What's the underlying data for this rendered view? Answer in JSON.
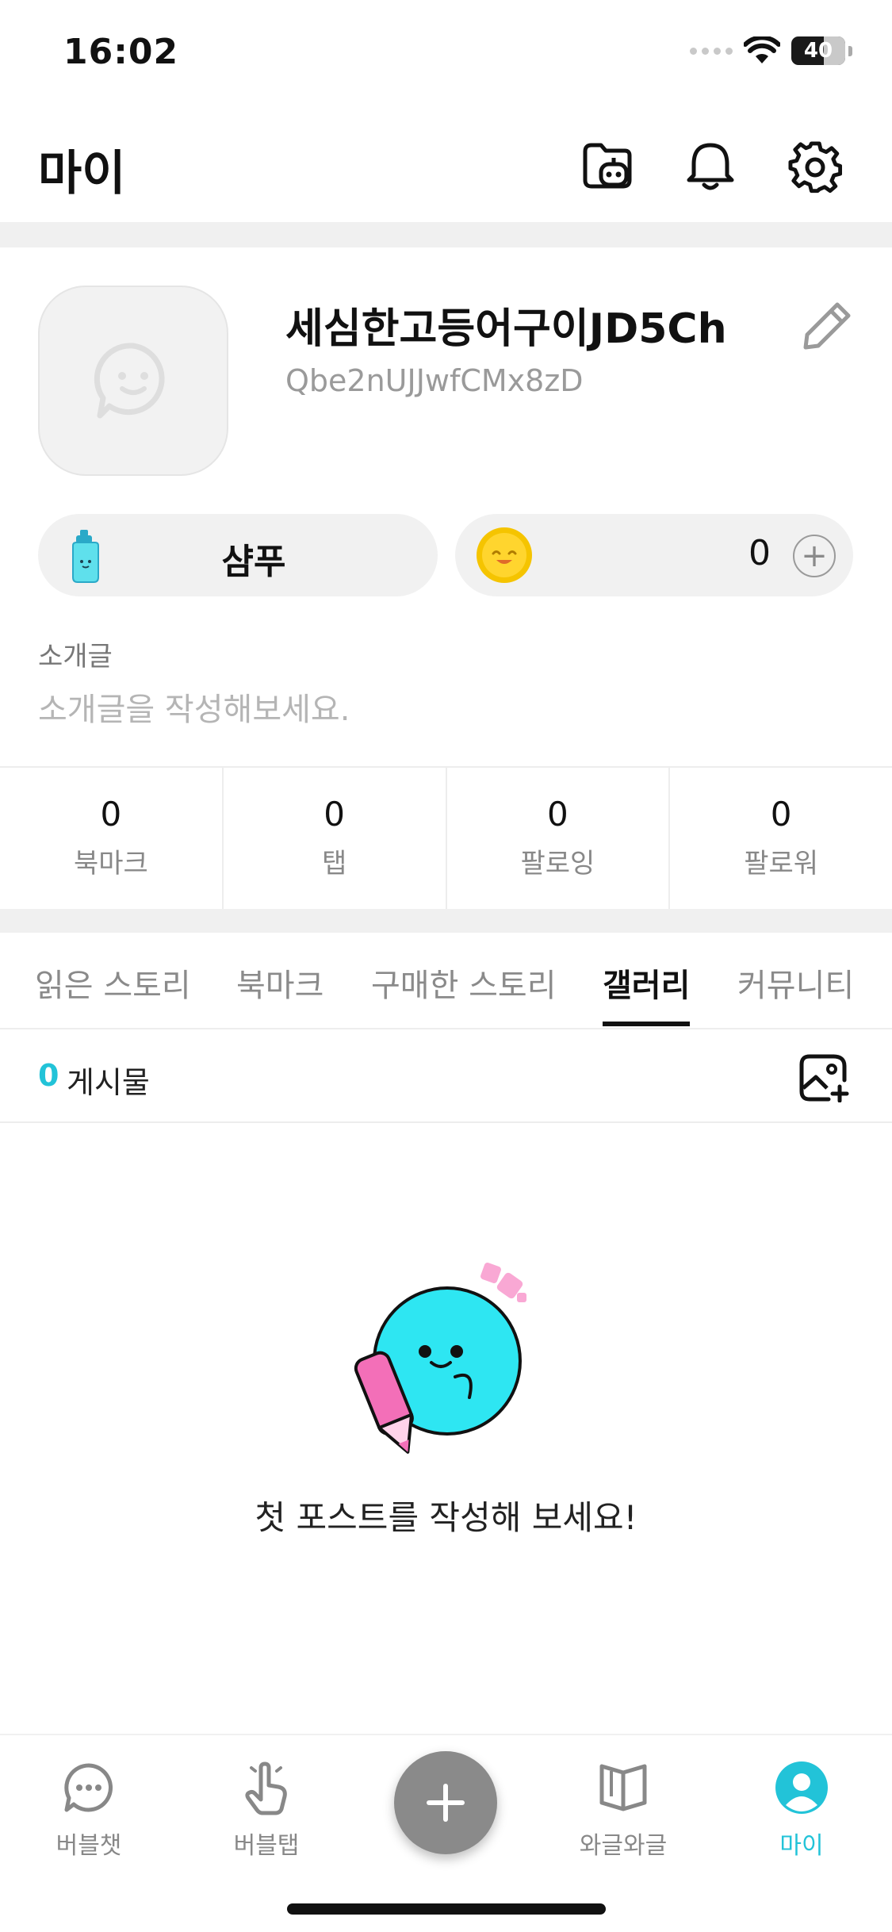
{
  "status_bar": {
    "time": "16:02",
    "battery": "40"
  },
  "header": {
    "title": "마이"
  },
  "profile": {
    "nickname": "세심한고등어구이JD5Ch",
    "user_id": "Qbe2nUJJwfCMx8zD"
  },
  "wallet": {
    "shampoo_label": "샴푸",
    "coin_value": "0",
    "coin_add_label": "+"
  },
  "intro": {
    "title": "소개글",
    "placeholder": "소개글을 작성해보세요."
  },
  "stats": [
    {
      "value": "0",
      "label": "북마크"
    },
    {
      "value": "0",
      "label": "탭"
    },
    {
      "value": "0",
      "label": "팔로잉"
    },
    {
      "value": "0",
      "label": "팔로워"
    }
  ],
  "tabs": [
    {
      "label": "읽은 스토리"
    },
    {
      "label": "북마크"
    },
    {
      "label": "구매한 스토리"
    },
    {
      "label": "갤러리",
      "active": true
    },
    {
      "label": "커뮤니티"
    }
  ],
  "posts": {
    "count": "0",
    "label": "게시물"
  },
  "empty_state": {
    "message": "첫 포스트를 작성해 보세요!"
  },
  "bottom_nav": [
    {
      "label": "버블챗",
      "icon": "chat-bubble-icon"
    },
    {
      "label": "버블탭",
      "icon": "tap-hand-icon"
    },
    {
      "label": "와글와글",
      "icon": "open-book-icon"
    },
    {
      "label": "마이",
      "icon": "profile-icon",
      "active": true
    }
  ],
  "colors": {
    "accent": "#22c3d8",
    "fab": "#8a8a8a",
    "coin": "#f5c400"
  }
}
